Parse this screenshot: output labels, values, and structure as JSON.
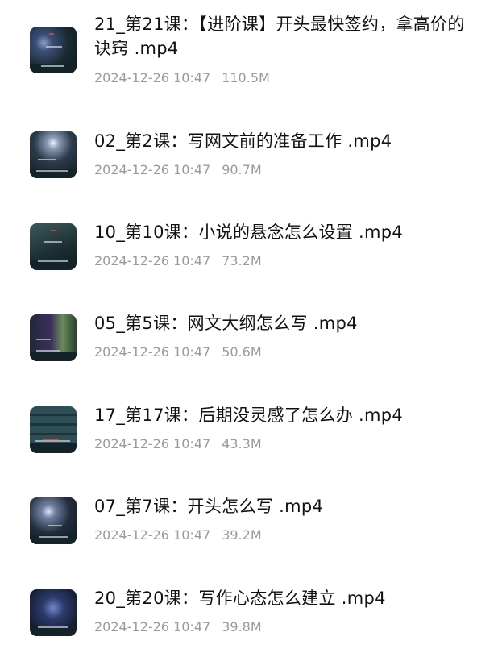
{
  "files": [
    {
      "title": "21_第21课：【进阶课】开头最快签约，拿高价的诀窍 .mp4",
      "date": "2024-12-26 10:47",
      "size": "110.5M"
    },
    {
      "title": "02_第2课：写网文前的准备工作 .mp4",
      "date": "2024-12-26 10:47",
      "size": "90.7M"
    },
    {
      "title": "10_第10课：小说的悬念怎么设置 .mp4",
      "date": "2024-12-26 10:47",
      "size": "73.2M"
    },
    {
      "title": "05_第5课：网文大纲怎么写 .mp4",
      "date": "2024-12-26 10:47",
      "size": "50.6M"
    },
    {
      "title": "17_第17课：后期没灵感了怎么办 .mp4",
      "date": "2024-12-26 10:47",
      "size": "43.3M"
    },
    {
      "title": "07_第7课：开头怎么写 .mp4",
      "date": "2024-12-26 10:47",
      "size": "39.2M"
    },
    {
      "title": "20_第20课：写作心态怎么建立 .mp4",
      "date": "2024-12-26 10:47",
      "size": "39.8M"
    }
  ]
}
